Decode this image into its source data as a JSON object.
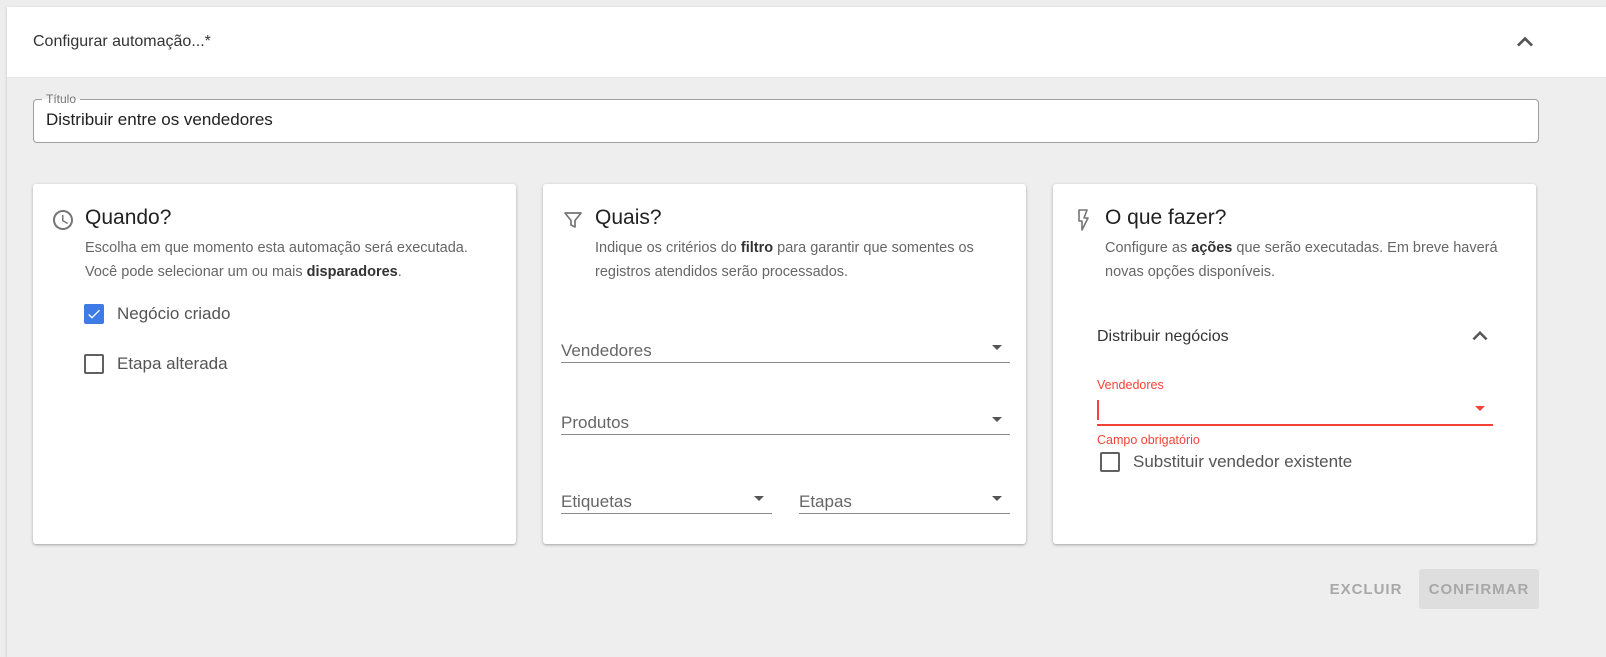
{
  "panel": {
    "title": "Configurar automação...*"
  },
  "title_field": {
    "label": "Título",
    "value": "Distribuir entre os vendedores"
  },
  "when_card": {
    "title": "Quando?",
    "desc_line1": "Escolha em que momento esta automação será executada.",
    "desc_line2_prefix": "Você pode selecionar um ou mais ",
    "desc_line2_bold": "disparadores",
    "desc_line2_suffix": ".",
    "triggers": [
      {
        "label": "Negócio criado",
        "checked": true
      },
      {
        "label": "Etapa alterada",
        "checked": false
      }
    ]
  },
  "which_card": {
    "title": "Quais?",
    "desc_prefix": "Indique os critérios do ",
    "desc_bold": "filtro",
    "desc_suffix": " para garantir que somentes os registros atendidos serão processados.",
    "filters": {
      "sellers": "Vendedores",
      "products": "Produtos",
      "tags": "Etiquetas",
      "stages": "Etapas"
    }
  },
  "what_card": {
    "title": "O que fazer?",
    "desc_prefix": "Configure as ",
    "desc_bold": "ações",
    "desc_suffix": " que serão executadas. Em breve haverá novas opções disponíveis.",
    "action": {
      "title": "Distribuir negócios",
      "field_label": "Vendedores",
      "field_value": "",
      "helper_text": "Campo obrigatório",
      "replace_label": "Substituir vendedor existente",
      "replace_checked": false
    }
  },
  "actions": {
    "delete_label": "EXCLUIR",
    "confirm_label": "CONFIRMAR"
  },
  "colors": {
    "accent": "#3f7be6",
    "error": "#f44336",
    "background": "#eeeeee"
  },
  "icons": {
    "collapse": "chevron-up-icon",
    "when": "clock-icon",
    "which": "filter-icon",
    "what": "flash-icon"
  }
}
